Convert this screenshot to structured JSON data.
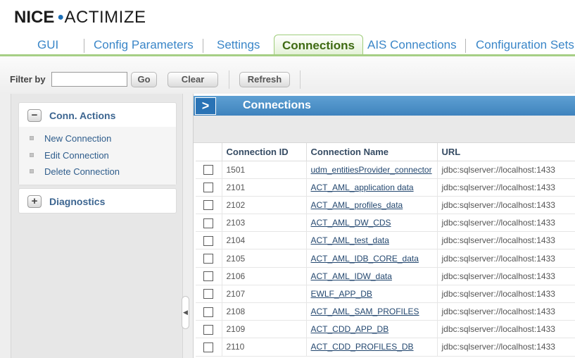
{
  "logo": {
    "part1": "NICE",
    "part2": "ACTIMIZE"
  },
  "tabs": [
    {
      "label": "GUI"
    },
    {
      "label": "Config Parameters"
    },
    {
      "label": "Settings"
    },
    {
      "label": "Connections"
    },
    {
      "label": "AIS Connections"
    },
    {
      "label": "Configuration Sets"
    }
  ],
  "active_tab": "Connections",
  "toolbar": {
    "filter_label": "Filter by",
    "filter_value": "",
    "go_label": "Go",
    "clear_label": "Clear",
    "refresh_label": "Refresh"
  },
  "sidebar": {
    "conn_actions": {
      "title": "Conn. Actions",
      "toggle": "−",
      "items": [
        {
          "label": "New Connection"
        },
        {
          "label": "Edit Connection"
        },
        {
          "label": "Delete Connection"
        }
      ]
    },
    "diagnostics": {
      "title": "Diagnostics",
      "toggle": "+"
    }
  },
  "panel": {
    "title": "Connections",
    "columns": {
      "id": "Connection ID",
      "name": "Connection Name",
      "url": "URL"
    },
    "rows": [
      {
        "id": "1501",
        "name": "udm_entitiesProvider_connector",
        "url": "jdbc:sqlserver://localhost:1433"
      },
      {
        "id": "2101",
        "name": "ACT_AML_application data",
        "url": "jdbc:sqlserver://localhost:1433"
      },
      {
        "id": "2102",
        "name": "ACT_AML_profiles_data",
        "url": "jdbc:sqlserver://localhost:1433"
      },
      {
        "id": "2103",
        "name": "ACT_AML_DW_CDS",
        "url": "jdbc:sqlserver://localhost:1433"
      },
      {
        "id": "2104",
        "name": "ACT_AML_test_data",
        "url": "jdbc:sqlserver://localhost:1433"
      },
      {
        "id": "2105",
        "name": "ACT_AML_IDB_CORE_data",
        "url": "jdbc:sqlserver://localhost:1433"
      },
      {
        "id": "2106",
        "name": "ACT_AML_IDW_data",
        "url": "jdbc:sqlserver://localhost:1433"
      },
      {
        "id": "2107",
        "name": "EWLF_APP_DB",
        "url": "jdbc:sqlserver://localhost:1433"
      },
      {
        "id": "2108",
        "name": "ACT_AML_SAM_PROFILES",
        "url": "jdbc:sqlserver://localhost:1433"
      },
      {
        "id": "2109",
        "name": "ACT_CDD_APP_DB",
        "url": "jdbc:sqlserver://localhost:1433"
      },
      {
        "id": "2110",
        "name": "ACT_CDD_PROFILES_DB",
        "url": "jdbc:sqlserver://localhost:1433"
      }
    ]
  },
  "colors": {
    "tab_link": "#3a86c8",
    "active_tab_text": "#3f6a13",
    "tab_underline": "#a6cf85",
    "panel_header": "#3f83bd",
    "section_title": "#3c6590"
  }
}
